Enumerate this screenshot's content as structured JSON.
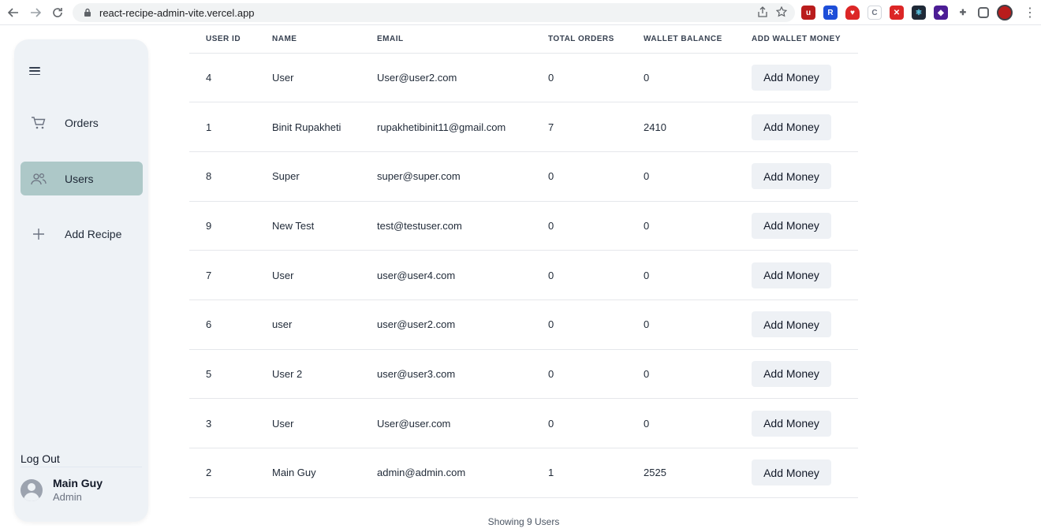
{
  "browser": {
    "url": "react-recipe-admin-vite.vercel.app"
  },
  "sidebar": {
    "items": [
      {
        "label": "Orders",
        "icon": "cart-icon",
        "active": false
      },
      {
        "label": "Users",
        "icon": "users-icon",
        "active": true
      },
      {
        "label": "Add Recipe",
        "icon": "plus-icon",
        "active": false
      }
    ],
    "logout_label": "Log Out",
    "user": {
      "name": "Main Guy",
      "role": "Admin"
    }
  },
  "table": {
    "headers": [
      "USER ID",
      "NAME",
      "EMAIL",
      "TOTAL ORDERS",
      "WALLET BALANCE",
      "ADD WALLET MONEY"
    ],
    "action_label": "Add Money",
    "rows": [
      {
        "id": "4",
        "name": "User",
        "email": "User@user2.com",
        "orders": "0",
        "wallet": "0"
      },
      {
        "id": "1",
        "name": "Binit Rupakheti",
        "email": "rupakhetibinit11@gmail.com",
        "orders": "7",
        "wallet": "2410"
      },
      {
        "id": "8",
        "name": "Super",
        "email": "super@super.com",
        "orders": "0",
        "wallet": "0"
      },
      {
        "id": "9",
        "name": "New Test",
        "email": "test@testuser.com",
        "orders": "0",
        "wallet": "0"
      },
      {
        "id": "7",
        "name": "User",
        "email": "user@user4.com",
        "orders": "0",
        "wallet": "0"
      },
      {
        "id": "6",
        "name": "user",
        "email": "user@user2.com",
        "orders": "0",
        "wallet": "0"
      },
      {
        "id": "5",
        "name": "User 2",
        "email": "user@user3.com",
        "orders": "0",
        "wallet": "0"
      },
      {
        "id": "3",
        "name": "User",
        "email": "User@user.com",
        "orders": "0",
        "wallet": "0"
      },
      {
        "id": "2",
        "name": "Main Guy",
        "email": "admin@admin.com",
        "orders": "1",
        "wallet": "2525"
      }
    ],
    "footer": "Showing 9 Users"
  },
  "colors": {
    "sidebar_bg": "#eef2f6",
    "active_nav_bg": "#adc8c8",
    "button_bg": "#eef1f5"
  }
}
